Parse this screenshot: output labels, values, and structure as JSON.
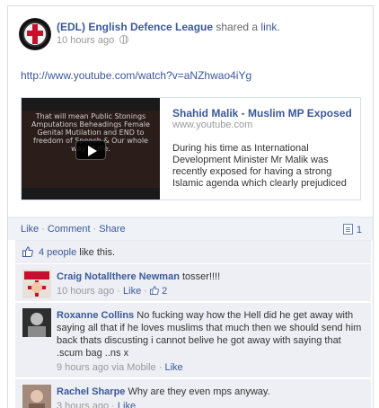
{
  "post": {
    "page_name": "(EDL) English Defence League",
    "shared_text": "shared a",
    "link_word": "link.",
    "time": "10 hours ago",
    "url": "http://www.youtube.com/watch?v=aNZhwao4iYg"
  },
  "share": {
    "title": "Shahid Malik - Muslim MP Exposed",
    "domain": "www.youtube.com",
    "description": "During his time as International Development Minister Mr Malik was recently exposed for having a strong Islamic agenda which clearly prejudiced",
    "thumb_text": "That will mean Public Stonings Amputations Beheadings Female Genital Mutilation and END to freedom of Speech & Our whole way of life."
  },
  "actions": {
    "like": "Like",
    "comment": "Comment",
    "share": "Share",
    "comment_count": "1"
  },
  "likes": {
    "count": "4 people",
    "suffix": "like this."
  },
  "comments": [
    {
      "name": "Craig Notallthere Newman",
      "text": "tosser!!!!",
      "time": "10 hours ago",
      "like": "Like",
      "likes": "2",
      "avatar_text": "ENGLAND"
    },
    {
      "name": "Roxanne Collins",
      "text": "No fucking way how the Hell did he get away with saying all that if he loves muslims that much then we should send him back thats discusting i cannot belive he got away with saying that .scum bag ..ns x",
      "time": "9 hours ago via Mobile",
      "like": "Like"
    },
    {
      "name": "Rachel Sharpe",
      "text": "Why are they even mps anyway.",
      "time": "3 hours ago",
      "like": "Like"
    }
  ],
  "colors": {
    "link": "#3b5998",
    "action_bar": "#eff2f7",
    "comment_bg": "#edeff4"
  }
}
